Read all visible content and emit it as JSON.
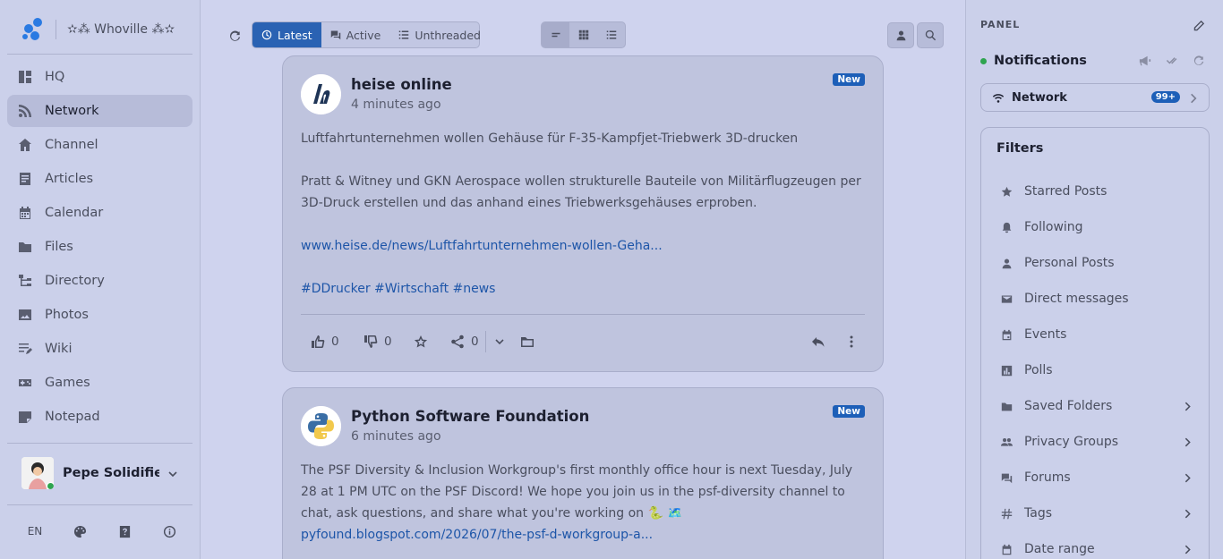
{
  "brand": {
    "site_name": "✫⁂ Whoville ⁂✫",
    "logo_color": "#2a7ae2"
  },
  "nav": {
    "items": [
      {
        "label": "HQ",
        "icon": "dashboard-icon"
      },
      {
        "label": "Network",
        "icon": "rss-icon",
        "active": true
      },
      {
        "label": "Channel",
        "icon": "home-icon"
      },
      {
        "label": "Articles",
        "icon": "article-icon"
      },
      {
        "label": "Calendar",
        "icon": "calendar-icon"
      },
      {
        "label": "Files",
        "icon": "folder-icon"
      },
      {
        "label": "Directory",
        "icon": "sitemap-icon"
      },
      {
        "label": "Photos",
        "icon": "image-icon"
      },
      {
        "label": "Wiki",
        "icon": "wiki-icon"
      },
      {
        "label": "Games",
        "icon": "gamepad-icon"
      },
      {
        "label": "Notepad",
        "icon": "note-icon"
      }
    ]
  },
  "user": {
    "name": "Pepe Solidifie..."
  },
  "footer": {
    "lang": "EN"
  },
  "toolbar": {
    "tabs": [
      {
        "label": "Latest",
        "icon": "clock-icon",
        "active": true
      },
      {
        "label": "Active",
        "icon": "chat-icon"
      },
      {
        "label": "Unthreaded",
        "icon": "list-icon"
      }
    ]
  },
  "posts": [
    {
      "author": "heise online",
      "time": "4 minutes ago",
      "badge": "New",
      "title": "Luftfahrtunternehmen wollen Gehäuse für F-35-Kampfjet-Triebwerk 3D-drucken",
      "text": "Pratt & Witney und GKN Aerospace wollen strukturelle Bauteile von Militärflugzeugen per 3D-Druck erstellen und das anhand eines Triebwerksgehäuses erproben.",
      "link": "www.heise.de/news/Luftfahrtunternehmen-wollen-Geha...",
      "tags": "#DDrucker #Wirtschaft #news",
      "likes": "0",
      "dislikes": "0",
      "shares": "0"
    },
    {
      "author": "Python Software Foundation",
      "time": "6 minutes ago",
      "badge": "New",
      "text": "The PSF Diversity & Inclusion Workgroup's first monthly office hour is next Tuesday, July 28 at 1 PM UTC on the PSF Discord! We hope you join us in the psf-diversity channel to chat, ask questions, and share what you're working on 🐍 🗺️",
      "link": "pyfound.blogspot.com/2026/07/the-psf-d-workgroup-a..."
    }
  ],
  "panel": {
    "title": "PANEL",
    "notifications": "Notifications",
    "network": "Network",
    "network_count": "99+",
    "filters_title": "Filters",
    "filters": [
      {
        "label": "Starred Posts",
        "icon": "star-icon"
      },
      {
        "label": "Following",
        "icon": "bell-icon"
      },
      {
        "label": "Personal Posts",
        "icon": "person-icon"
      },
      {
        "label": "Direct messages",
        "icon": "envelope-icon"
      },
      {
        "label": "Events",
        "icon": "event-icon"
      },
      {
        "label": "Polls",
        "icon": "poll-icon"
      },
      {
        "label": "Saved Folders",
        "icon": "folder-icon",
        "arrow": true
      },
      {
        "label": "Privacy Groups",
        "icon": "group-icon",
        "arrow": true
      },
      {
        "label": "Forums",
        "icon": "forum-icon",
        "arrow": true
      },
      {
        "label": "Tags",
        "icon": "hash-icon",
        "arrow": true
      },
      {
        "label": "Date range",
        "icon": "calendar-icon",
        "arrow": true
      }
    ]
  }
}
